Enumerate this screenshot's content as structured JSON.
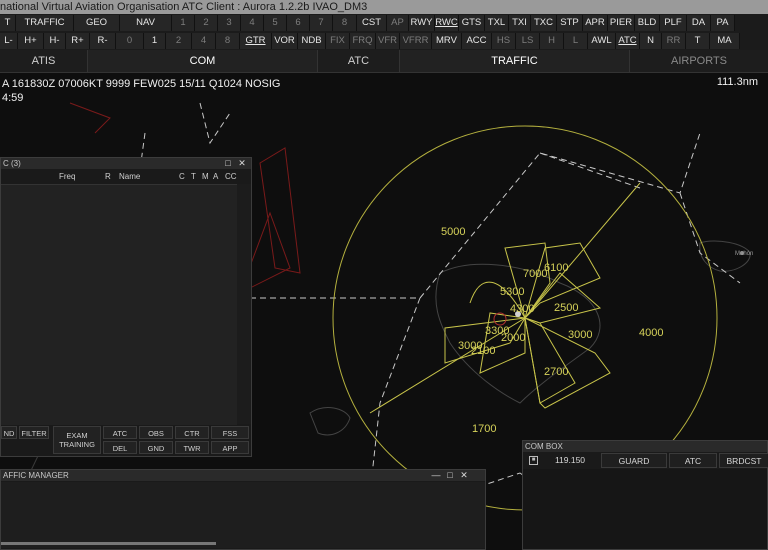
{
  "window": {
    "title": "national Virtual Aviation Organisation  ATC Client : Aurora 1.2.2b  IVAO_DM3"
  },
  "toolbar1": [
    {
      "label": "T",
      "dim": false
    },
    {
      "label": "TRAFFIC",
      "dim": false
    },
    {
      "label": "GEO",
      "dim": false
    },
    {
      "label": "NAV",
      "dim": false
    },
    {
      "label": "1",
      "dim": true
    },
    {
      "label": "2",
      "dim": true
    },
    {
      "label": "3",
      "dim": true
    },
    {
      "label": "4",
      "dim": true
    },
    {
      "label": "5",
      "dim": true
    },
    {
      "label": "6",
      "dim": true
    },
    {
      "label": "7",
      "dim": true
    },
    {
      "label": "8",
      "dim": true
    },
    {
      "label": "CST",
      "dim": false
    },
    {
      "label": "AP",
      "dim": true
    },
    {
      "label": "RWY",
      "dim": false
    },
    {
      "label": "RWC",
      "dim": false,
      "ul": true
    },
    {
      "label": "GTS",
      "dim": false
    },
    {
      "label": "TXL",
      "dim": false
    },
    {
      "label": "TXI",
      "dim": false
    },
    {
      "label": "TXC",
      "dim": false
    },
    {
      "label": "STP",
      "dim": false
    },
    {
      "label": "APR",
      "dim": false
    },
    {
      "label": "PIER",
      "dim": false
    },
    {
      "label": "BLD",
      "dim": false
    },
    {
      "label": "PLF",
      "dim": false
    },
    {
      "label": "DA",
      "dim": false
    },
    {
      "label": "PA",
      "dim": false
    }
  ],
  "toolbar2": [
    {
      "label": "L-",
      "dim": false
    },
    {
      "label": "H+",
      "dim": false
    },
    {
      "label": "H-",
      "dim": false
    },
    {
      "label": "R+",
      "dim": false
    },
    {
      "label": "R-",
      "dim": false
    },
    {
      "label": "0",
      "dim": true
    },
    {
      "label": "1",
      "dim": false
    },
    {
      "label": "2",
      "dim": true
    },
    {
      "label": "4",
      "dim": true
    },
    {
      "label": "8",
      "dim": true
    },
    {
      "label": "GTR",
      "dim": false,
      "ul": true
    },
    {
      "label": "VOR",
      "dim": false
    },
    {
      "label": "NDB",
      "dim": false
    },
    {
      "label": "FIX",
      "dim": true
    },
    {
      "label": "FRQ",
      "dim": true
    },
    {
      "label": "VFR",
      "dim": true
    },
    {
      "label": "VFRR",
      "dim": true
    },
    {
      "label": "MRV",
      "dim": false
    },
    {
      "label": "ACC",
      "dim": false
    },
    {
      "label": "HS",
      "dim": true
    },
    {
      "label": "LS",
      "dim": true
    },
    {
      "label": "H",
      "dim": true
    },
    {
      "label": "L",
      "dim": true
    },
    {
      "label": "AWL",
      "dim": false
    },
    {
      "label": "ATC",
      "dim": false,
      "ul": true
    },
    {
      "label": "N",
      "dim": false
    },
    {
      "label": "RR",
      "dim": true
    },
    {
      "label": "T",
      "dim": false
    },
    {
      "label": "MA",
      "dim": false
    }
  ],
  "tabs": [
    {
      "label": "ATIS",
      "state": "normal"
    },
    {
      "label": "COM",
      "state": "sel"
    },
    {
      "label": "ATC",
      "state": "normal"
    },
    {
      "label": "TRAFFIC",
      "state": "sel"
    },
    {
      "label": "AIRPORTS",
      "state": "dim"
    }
  ],
  "metar": "A 161830Z 07006KT 9999 FEW025 15/11 Q1024 NOSIG",
  "time": "4:59",
  "range": "111.3nm",
  "altitudes": [
    {
      "label": "5000"
    },
    {
      "label": "7000"
    },
    {
      "label": "6100"
    },
    {
      "label": "5300"
    },
    {
      "label": "4300"
    },
    {
      "label": "2500"
    },
    {
      "label": "3300"
    },
    {
      "label": "2000"
    },
    {
      "label": "3000"
    },
    {
      "label": "2100"
    },
    {
      "label": "3000"
    },
    {
      "label": "4000"
    },
    {
      "label": "2700"
    },
    {
      "label": "1700"
    }
  ],
  "city_label": "Mahón",
  "atc_window": {
    "title": "C (3)",
    "columns": [
      "Freq",
      "R",
      "Name",
      "C",
      "T",
      "M",
      "A",
      "CC"
    ],
    "buttons": [
      "ND",
      "FILTER",
      "EXAM TRAINING",
      "ATC",
      "OBS",
      "CTR",
      "FSS",
      "DEL",
      "GND",
      "TWR",
      "APP"
    ]
  },
  "traffic_manager": {
    "title": "AFFIC MANAGER"
  },
  "combox": {
    "title": "COM BOX",
    "frequency": "119.150",
    "buttons": [
      "GUARD",
      "ATC",
      "BRDCST"
    ]
  },
  "colors": {
    "sector": "#c8c44a",
    "ring": "#b4b03e",
    "accent": "#d6d25a"
  }
}
